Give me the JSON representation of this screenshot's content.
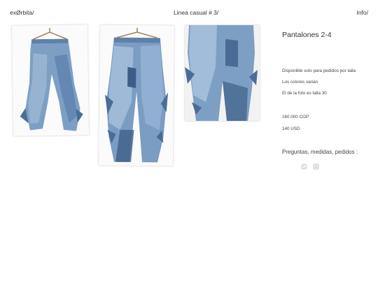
{
  "header": {
    "brand": "exØrbita/",
    "collection": "Linea casual # 3/",
    "info": "Info/"
  },
  "gallery": {
    "images": [
      {
        "alt": "front-view-jeans-on-hanger"
      },
      {
        "alt": "front-view-jeans-on-hanger-detail"
      },
      {
        "alt": "back-view-jeans-closeup"
      }
    ]
  },
  "product": {
    "title": "Pantalones 2-4",
    "availability": "Disponible solo para pedidos por talla",
    "colors_note": "Los colores varian",
    "photo_size": "El de la foto es talla 30",
    "price_cop": "160.000 COP",
    "price_usd": "140 USD",
    "questions": "Preguntas, medidas, pedidos :"
  },
  "icons": [
    "whatsapp-icon",
    "instagram-icon"
  ],
  "colors": {
    "denim_light": "#8fb0cf",
    "denim_mid": "#6a8fb6",
    "denim_dark": "#3f5f88",
    "icon_gray": "#b3b3b3"
  }
}
